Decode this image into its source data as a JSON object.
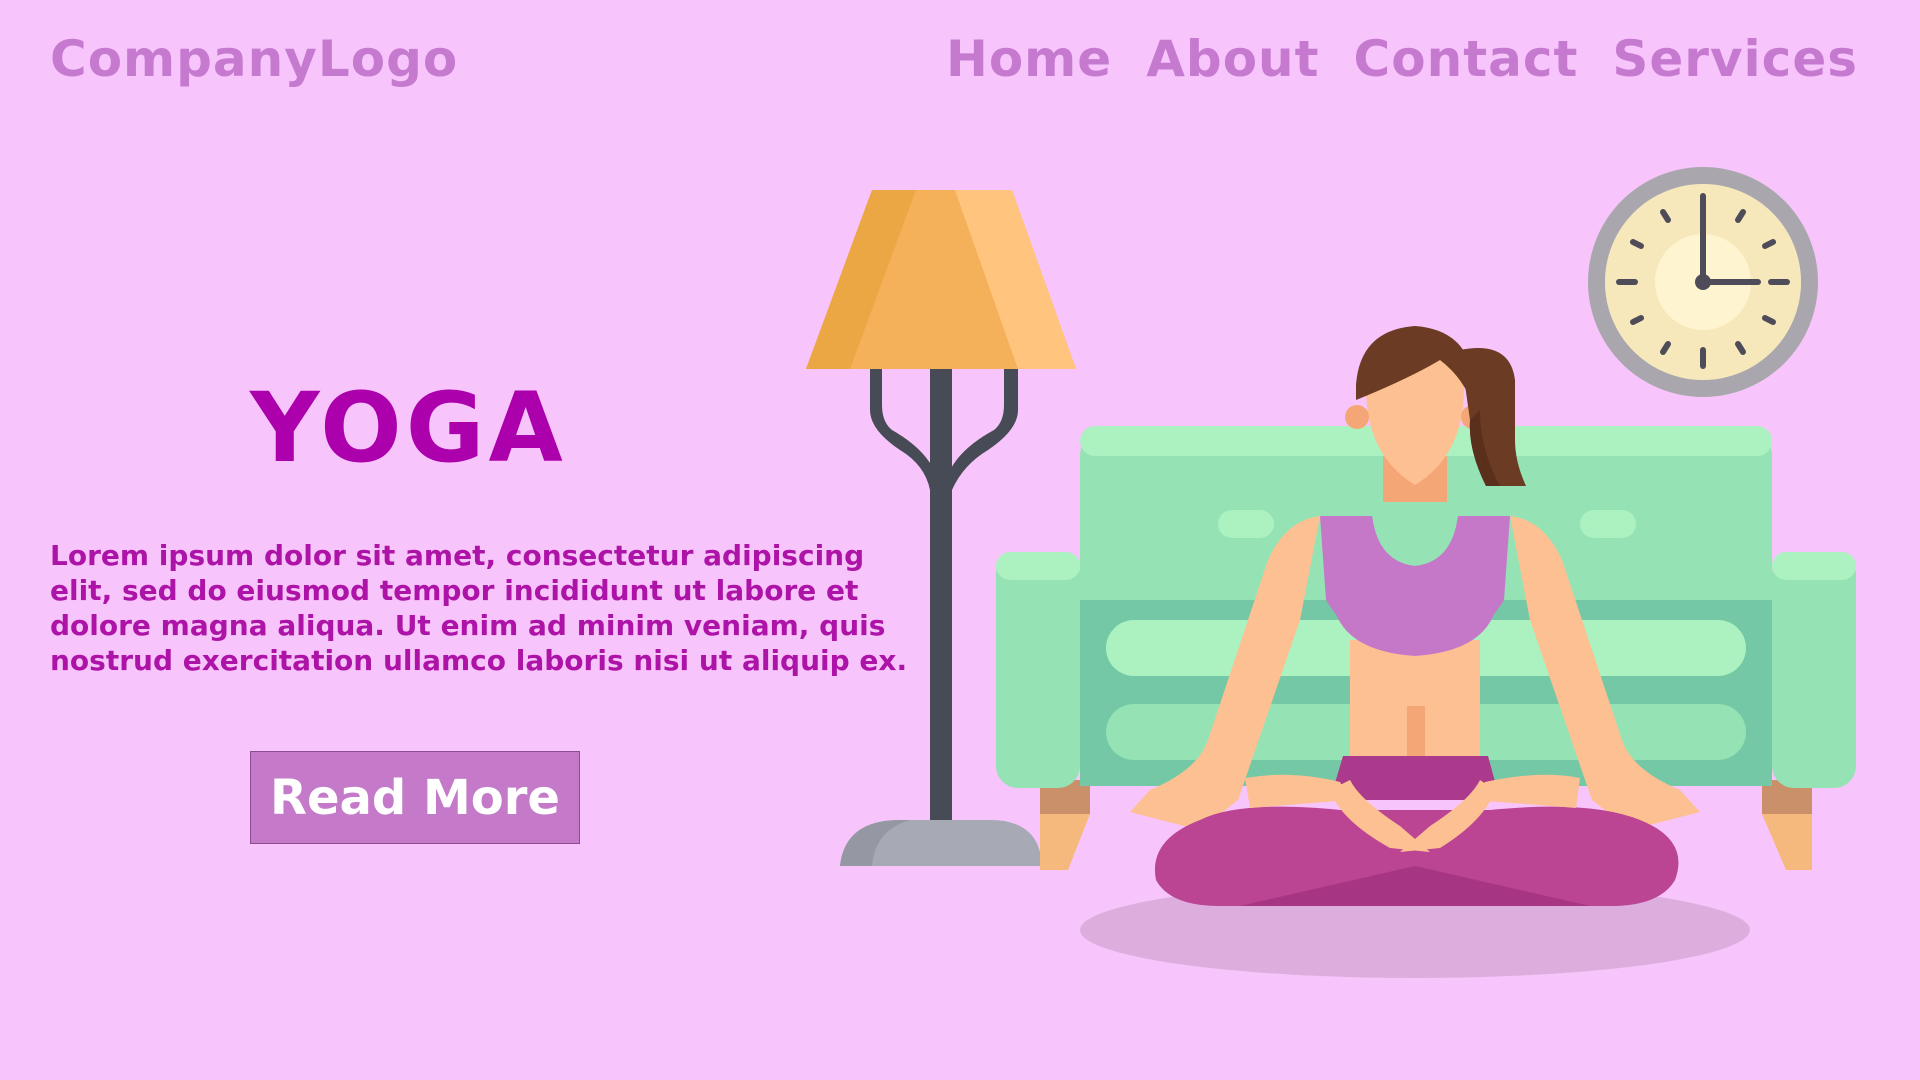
{
  "header": {
    "logo_text": "CompanyLogo",
    "nav": [
      {
        "label": "Home"
      },
      {
        "label": "About"
      },
      {
        "label": "Contact"
      },
      {
        "label": "Services"
      }
    ]
  },
  "hero": {
    "title": "YOGA",
    "body": "Lorem ipsum dolor sit amet, consectetur adipiscing elit, sed do eiusmod tempor incididunt ut labore et dolore magna aliqua. Ut enim ad minim veniam, quis nostrud exercitation ullamco laboris nisi ut aliquip ex.",
    "cta_label": "Read More"
  },
  "illustration": {
    "elements": [
      "floor-lamp",
      "wall-clock",
      "sofa",
      "yoga-woman"
    ]
  },
  "colors": {
    "background": "#f7c5fb",
    "nav_text": "#c57ad0",
    "title": "#ad00ad",
    "body_text": "#ad13a7",
    "button_bg": "#c57ac9",
    "button_text": "#ffffff"
  }
}
